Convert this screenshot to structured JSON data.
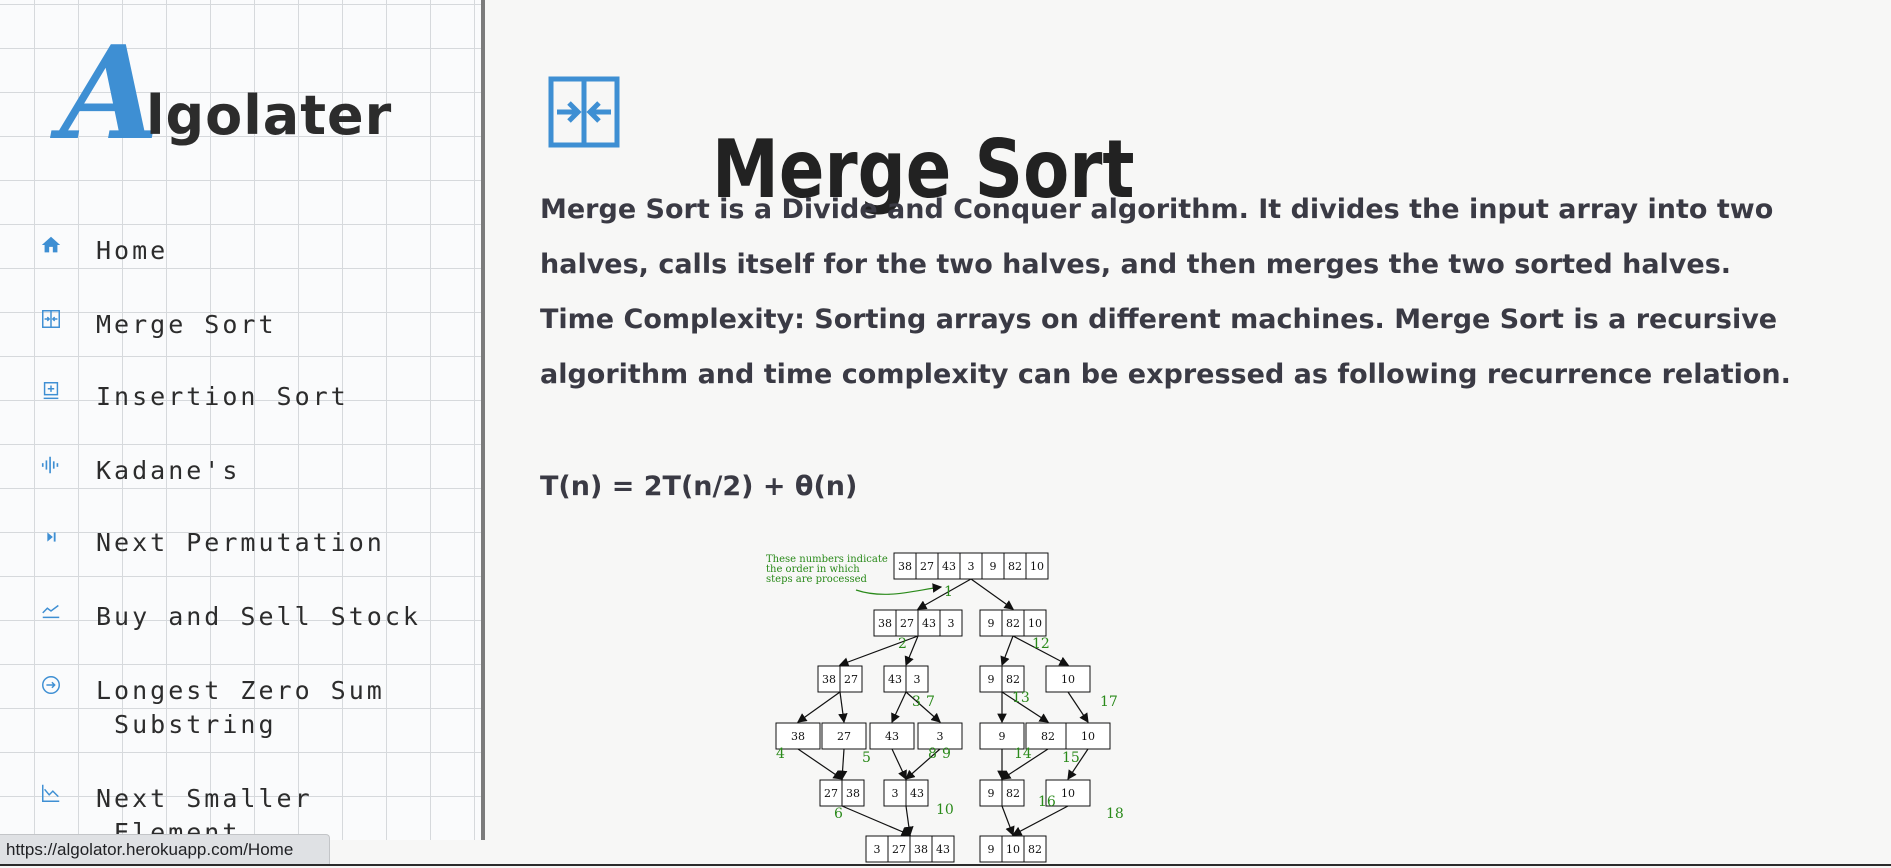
{
  "sidebar": {
    "logo": {
      "first": "A",
      "rest": "lgolater"
    },
    "items": [
      {
        "label": "Home",
        "icon": "home-icon"
      },
      {
        "label": "Merge Sort",
        "icon": "merge-icon"
      },
      {
        "label": "Insertion Sort",
        "icon": "insert-icon"
      },
      {
        "label": "Kadane's",
        "icon": "waveform-icon"
      },
      {
        "label": "Next Permutation",
        "icon": "skip-next-icon"
      },
      {
        "label": "Buy and Sell Stock",
        "icon": "trending-icon"
      },
      {
        "label": "Longest Zero Sum\n Substring",
        "icon": "arrow-circle-icon"
      },
      {
        "label": "Next Smaller\n Element",
        "icon": "chart-down-icon"
      }
    ]
  },
  "status_url": "https://algolator.herokuapp.com/Home",
  "main": {
    "title": "Merge Sort",
    "description": "Merge Sort is a Divide and Conquer algorithm. It divides the input array into two halves, calls itself for the two halves, and then merges the two sorted halves.",
    "complexity": "Time Complexity: Sorting arrays on different machines. Merge Sort is a recursive algorithm and time complexity can be expressed as following recurrence relation.",
    "recurrence": "T(n) = 2T(n/2) + θ(n)"
  },
  "diagram": {
    "note": [
      "These numbers indicate",
      "the order in which",
      "steps are processed"
    ],
    "rows": [
      [
        [
          "38",
          "27",
          "43",
          "3",
          "9",
          "82",
          "10"
        ]
      ],
      [
        [
          "38",
          "27",
          "43",
          "3"
        ],
        [
          "9",
          "82",
          "10"
        ]
      ],
      [
        [
          "38",
          "27"
        ],
        [
          "43",
          "3"
        ],
        [
          "9",
          "82"
        ],
        [
          "10"
        ]
      ],
      [
        [
          "38"
        ],
        [
          "27"
        ],
        [
          "43"
        ],
        [
          "3"
        ],
        [
          "9"
        ],
        [
          "82"
        ],
        [
          "10"
        ]
      ],
      [
        [
          "27",
          "38"
        ],
        [
          "3",
          "43"
        ],
        [
          "9",
          "82"
        ],
        [
          "10"
        ]
      ],
      [
        [
          "3",
          "27",
          "38",
          "43"
        ],
        [
          "9",
          "10",
          "82"
        ]
      ]
    ],
    "step_numbers": [
      "1",
      "2",
      "3",
      "4",
      "5",
      "6",
      "7",
      "8",
      "9",
      "10",
      "12",
      "13",
      "14",
      "15",
      "16",
      "17",
      "18"
    ]
  },
  "colors": {
    "accent": "#3e8fd3",
    "step_green": "#2a8a1a"
  }
}
